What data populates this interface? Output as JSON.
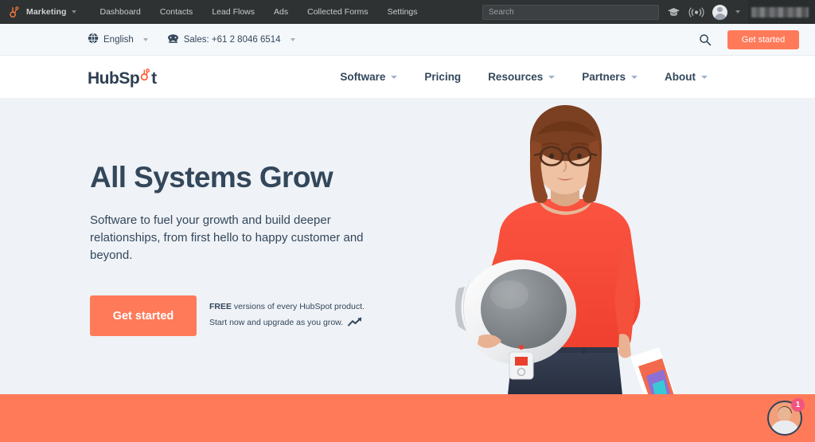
{
  "appbar": {
    "logo_icon": "hubspot-sprocket-icon",
    "brand": "Marketing",
    "links": [
      "Dashboard",
      "Contacts",
      "Lead Flows",
      "Ads",
      "Collected Forms",
      "Settings"
    ],
    "search_placeholder": "Search",
    "search_value": "",
    "icons": [
      "academy-cap-icon",
      "broadcast-icon",
      "user-avatar-icon"
    ],
    "background_color": "#2e3233"
  },
  "utilbar": {
    "language_icon": "globe-icon",
    "language": "English",
    "phone_icon": "telephone-icon",
    "sales": "Sales: +61 2 8046 6514",
    "search_icon": "search-icon",
    "cta_label": "Get started",
    "background_color": "#f5f8fa"
  },
  "mainnav": {
    "logo_text_a": "HubSp",
    "logo_text_b": "t",
    "logo_icon": "hubspot-sprocket-icon",
    "items": [
      {
        "label": "Software",
        "has_caret": true
      },
      {
        "label": "Pricing",
        "has_caret": false
      },
      {
        "label": "Resources",
        "has_caret": true
      },
      {
        "label": "Partners",
        "has_caret": true
      },
      {
        "label": "About",
        "has_caret": true
      }
    ]
  },
  "hero": {
    "title": "All Systems Grow",
    "subtitle": "Software to fuel your growth and build deeper relationships, from first hello to happy customer and beyond.",
    "cta_label": "Get started",
    "note_bold": "FREE",
    "note_line1_rest": " versions of every HubSpot product.",
    "note_line2": "Start now and upgrade as you grow.",
    "note_icon": "trending-up-arrow-icon",
    "photo_alt": "woman-holding-astronaut-helmet-photo",
    "background_color": "#eff2f6"
  },
  "footer_band": {
    "color": "#ff7a59"
  },
  "chat": {
    "avatar_icon": "chat-agent-avatar-icon",
    "badge_count": "1",
    "badge_color": "#f2547d"
  },
  "colors": {
    "brand_orange": "#ff7a59",
    "navy": "#33475b",
    "dark_bar": "#2e3233"
  }
}
